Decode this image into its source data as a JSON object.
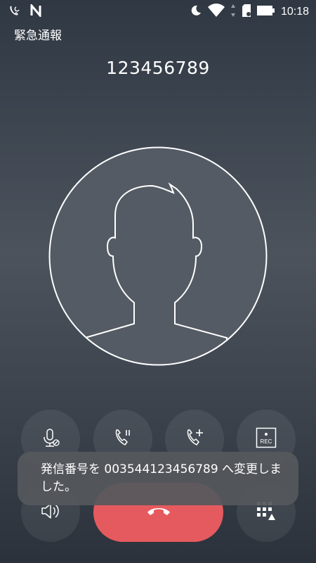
{
  "status_bar": {
    "time": "10:18",
    "icons_left": [
      "do-not-disturb-call-icon",
      "n-logo-icon"
    ],
    "icons_right": [
      "moon-icon",
      "wifi-icon",
      "data-arrows-icon",
      "sim-card-icon",
      "battery-icon"
    ]
  },
  "call": {
    "header_label": "緊急通報",
    "number": "123456789"
  },
  "controls": {
    "row1": [
      "mute-icon",
      "hold-icon",
      "add-call-icon",
      "record-icon"
    ],
    "row2": [
      "speaker-icon",
      "keypad-icon"
    ],
    "record_label": "REC",
    "end_call_icon": "end-call-icon"
  },
  "toast": {
    "message": "発信番号を 003544123456789 へ変更しました。"
  },
  "colors": {
    "end_call": "#e55a5e",
    "background_top": "#2f3843",
    "toast_bg": "#55585c"
  }
}
